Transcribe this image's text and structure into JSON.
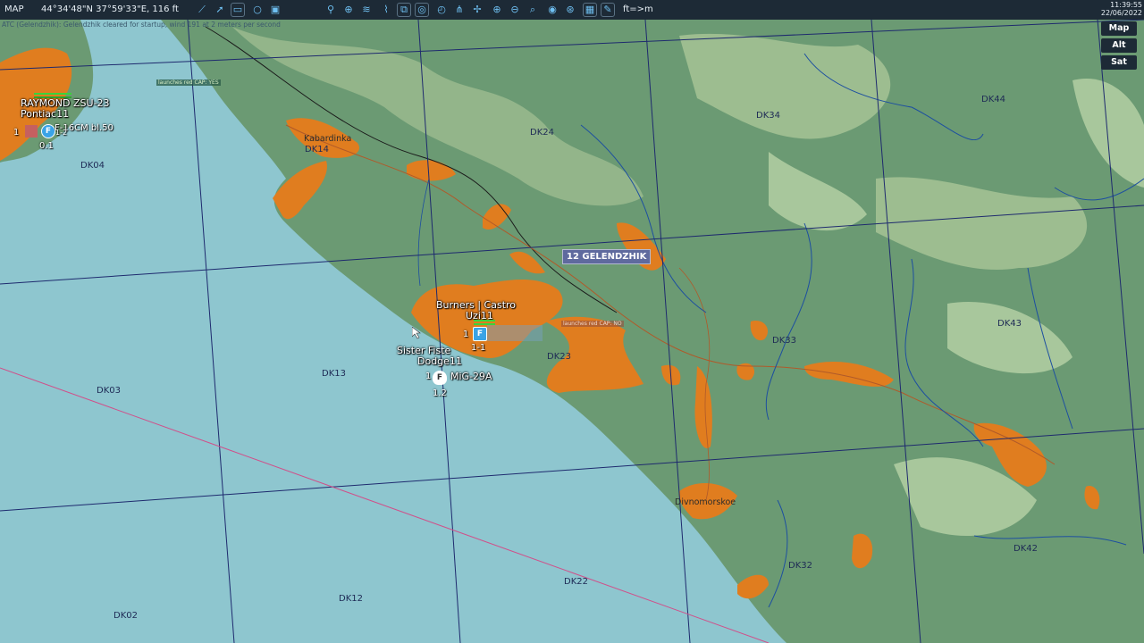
{
  "topbar": {
    "mode": "MAP",
    "coords": "44°34'48\"N 37°59'33\"E, 116 ft",
    "units": "ft=>m",
    "time": "11:39:55",
    "date": "22/06/2022",
    "icons": [
      "draw-line-icon",
      "waypoint-icon",
      "ruler-icon",
      "circle-icon",
      "camera-icon",
      "antenna-icon",
      "crosshair-icon",
      "wifi-icon",
      "marker-icon",
      "zoom-view-icon",
      "target-icon",
      "clock-icon",
      "filter-icon",
      "grid-snap-icon",
      "zoom-in-icon",
      "zoom-out-icon",
      "search-icon",
      "radar-icon",
      "globe-icon",
      "grid-icon",
      "pencil-icon"
    ],
    "accent": "#6fc0f2"
  },
  "status_line": "ATC (Gelendzhik): Gelendzhik cleared for startup, wind 191 at 2 meters per second",
  "layers": {
    "map": "Map",
    "alt": "Alt",
    "sat": "Sat"
  },
  "map": {
    "airfield": "12 GELENDZHIK",
    "grid_labels": [
      "DK04",
      "DK14",
      "DK24",
      "DK34",
      "DK44",
      "DK03",
      "DK13",
      "DK23",
      "DK33",
      "DK43",
      "DK02",
      "DK12",
      "DK22",
      "DK32",
      "DK42"
    ],
    "towns": [
      "Kabardinka",
      "Divnomorskoe"
    ],
    "units": {
      "north": {
        "name": "RAYMOND",
        "type": "ZSU-23",
        "callsign": "Pontiac11",
        "aircraft": "F-16CM bl.50",
        "icon": "F",
        "count": "1",
        "sub": "1-2",
        "altitude": "0.1"
      },
      "center": {
        "name": "Burners | Castro",
        "callsign": "Uzi11",
        "count": "1",
        "sub": "1-1",
        "icon": "F"
      },
      "south": {
        "name": "Sister Fiste",
        "callsign": "Dodge11",
        "count": "1",
        "aircraft": "MiG-29A",
        "icon": "F",
        "altitude": "1.2"
      }
    },
    "notes": {
      "north": "launches red CAP: YES",
      "center": "launches red CAP: NO"
    },
    "colors": {
      "sea": "#8ec6cf",
      "land": "#6b9a73",
      "town": "#e07d1f",
      "friendly": "#3aa3e6"
    }
  }
}
